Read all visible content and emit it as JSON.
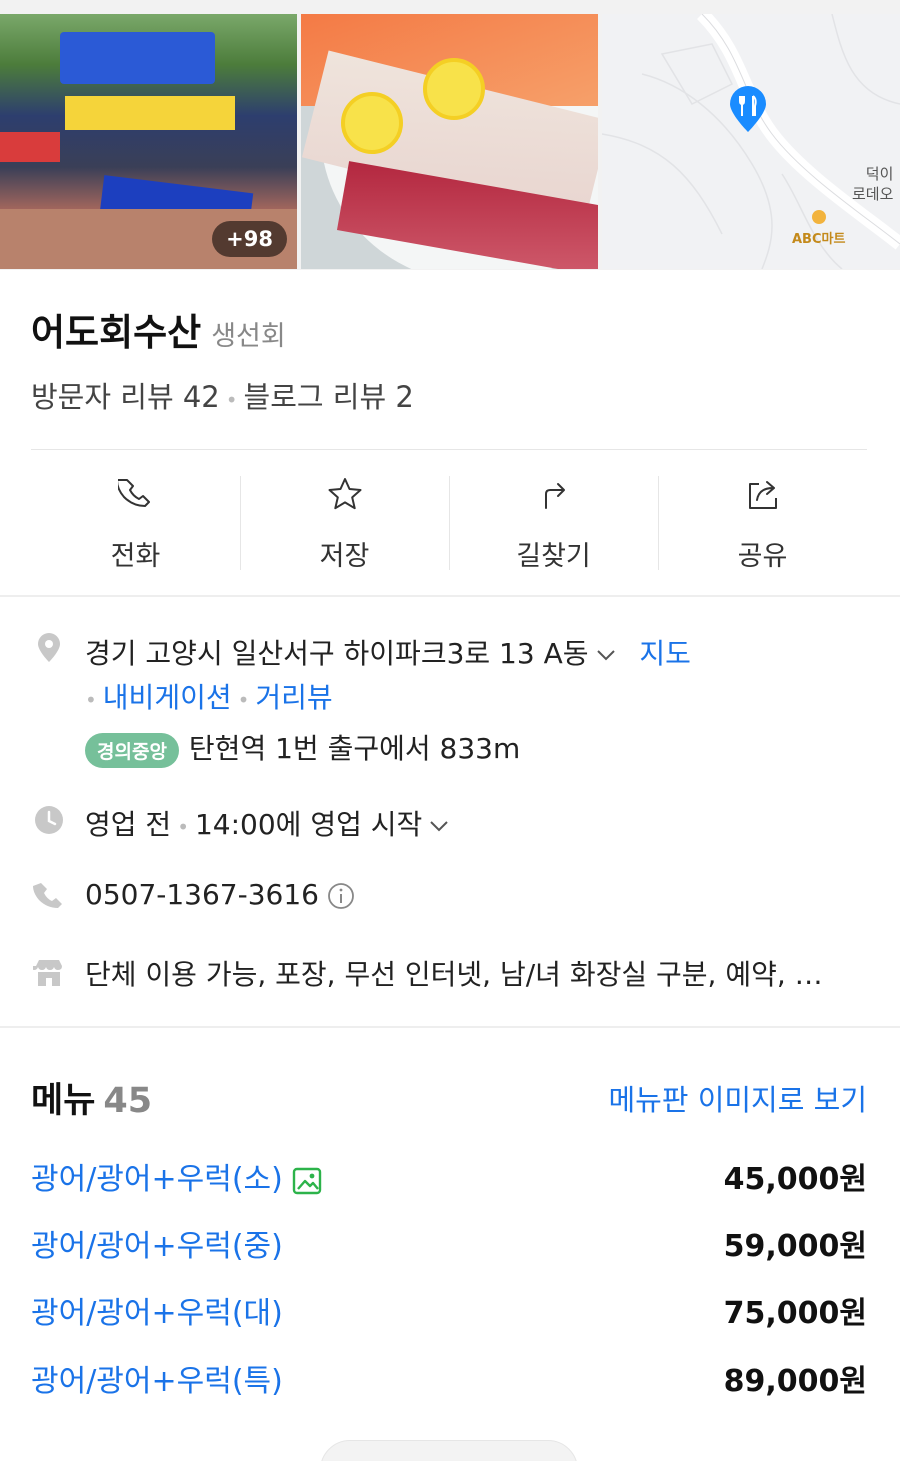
{
  "photos": {
    "count_badge": "+98",
    "map": {
      "label_right": "덕이\n로데오",
      "label_mart": "ABC마트",
      "pin_icon": "restaurant-pin-icon"
    }
  },
  "place": {
    "name": "어도회수산",
    "category": "생선회",
    "visitor_reviews": "방문자 리뷰 42",
    "blog_reviews": "블로그 리뷰 2"
  },
  "actions": [
    {
      "label": "전화",
      "icon": "phone-icon"
    },
    {
      "label": "저장",
      "icon": "star-icon"
    },
    {
      "label": "길찾기",
      "icon": "directions-icon"
    },
    {
      "label": "공유",
      "icon": "share-icon"
    }
  ],
  "info": {
    "address": "경기 고양시 일산서구 하이파크3로 13 A동",
    "map_link": "지도",
    "navigation_link": "내비게이션",
    "street_view_link": "거리뷰",
    "subway_line": "경의중앙",
    "subway_text": "탄현역 1번 출구에서 833m",
    "status": "영업 전",
    "hours_text": "14:00에 영업 시작",
    "phone": "0507-1367-3616",
    "amenities": "단체 이용 가능, 포장, 무선 인터넷, 남/녀 화장실 구분, 예약, …"
  },
  "menu": {
    "title": "메뉴",
    "count": "45",
    "image_link": "메뉴판 이미지로 보기",
    "items": [
      {
        "name": "광어/광어+우럭(소)",
        "price": "45,000원",
        "has_image": true
      },
      {
        "name": "광어/광어+우럭(중)",
        "price": "59,000원",
        "has_image": false
      },
      {
        "name": "광어/광어+우럭(대)",
        "price": "75,000원",
        "has_image": false
      },
      {
        "name": "광어/광어+우럭(특)",
        "price": "89,000원",
        "has_image": false
      }
    ]
  },
  "colors": {
    "link": "#1a73e8",
    "pin": "#1a8cff",
    "subway_badge": "#76c09a"
  }
}
